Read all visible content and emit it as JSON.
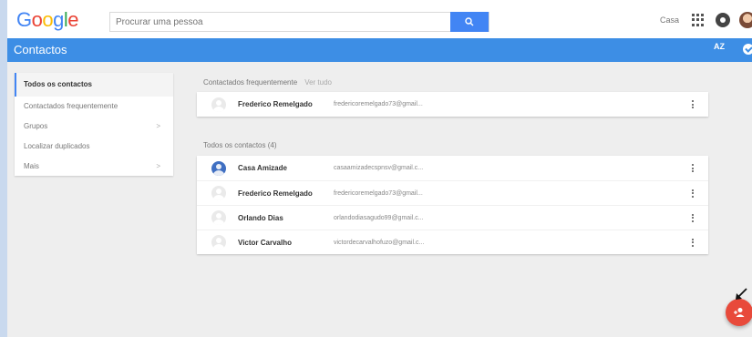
{
  "header": {
    "logo_letters": [
      {
        "ch": "G",
        "color": "#4285f4"
      },
      {
        "ch": "o",
        "color": "#ea4335"
      },
      {
        "ch": "o",
        "color": "#fbbc05"
      },
      {
        "ch": "g",
        "color": "#4285f4"
      },
      {
        "ch": "l",
        "color": "#34a853"
      },
      {
        "ch": "e",
        "color": "#ea4335"
      }
    ],
    "search_placeholder": "Procurar uma pessoa",
    "account_link": "Casa"
  },
  "appbar": {
    "title": "Contactos",
    "sort_label": "AZ",
    "color": "#3d8ee5"
  },
  "sidebar": {
    "items": [
      {
        "label": "Todos os contactos",
        "active": true,
        "chevron": false
      },
      {
        "label": "Contactados frequentemente",
        "active": false,
        "chevron": false
      },
      {
        "label": "Grupos",
        "active": false,
        "chevron": true
      },
      {
        "label": "Localizar duplicados",
        "active": false,
        "chevron": false
      },
      {
        "label": "Mais",
        "active": false,
        "chevron": true
      }
    ]
  },
  "frequent": {
    "title": "Contactados frequentemente",
    "view_all": "Ver tudo",
    "rows": [
      {
        "name": "Frederico Remelgado",
        "email": "fredericoremelgado73@gmail..."
      }
    ]
  },
  "all": {
    "title": "Todos os contactos (4)",
    "rows": [
      {
        "name": "Casa Amizade",
        "email": "casaamizadecspnsv@gmail.c...",
        "avatar": "filled"
      },
      {
        "name": "Frederico Remelgado",
        "email": "fredericoremelgado73@gmail...",
        "avatar": "default"
      },
      {
        "name": "Orlando Dias",
        "email": "orlandodiasagudo99@gmail.c...",
        "avatar": "default"
      },
      {
        "name": "Victor Carvalho",
        "email": "victordecarvalhofuzo@gmail.c...",
        "avatar": "default"
      }
    ]
  },
  "icons": {
    "search": "search-icon",
    "apps": "apps-grid-icon",
    "notifications": "notifications-icon",
    "avatar": "account-avatar",
    "sort": "sort-az-icon",
    "more": "more-options-icon",
    "fab": "add-contact-icon",
    "row_menu": "more-vert-icon"
  },
  "colors": {
    "accent": "#3d8ee5",
    "search_button": "#4285f4",
    "fab": "#e84a3b"
  }
}
